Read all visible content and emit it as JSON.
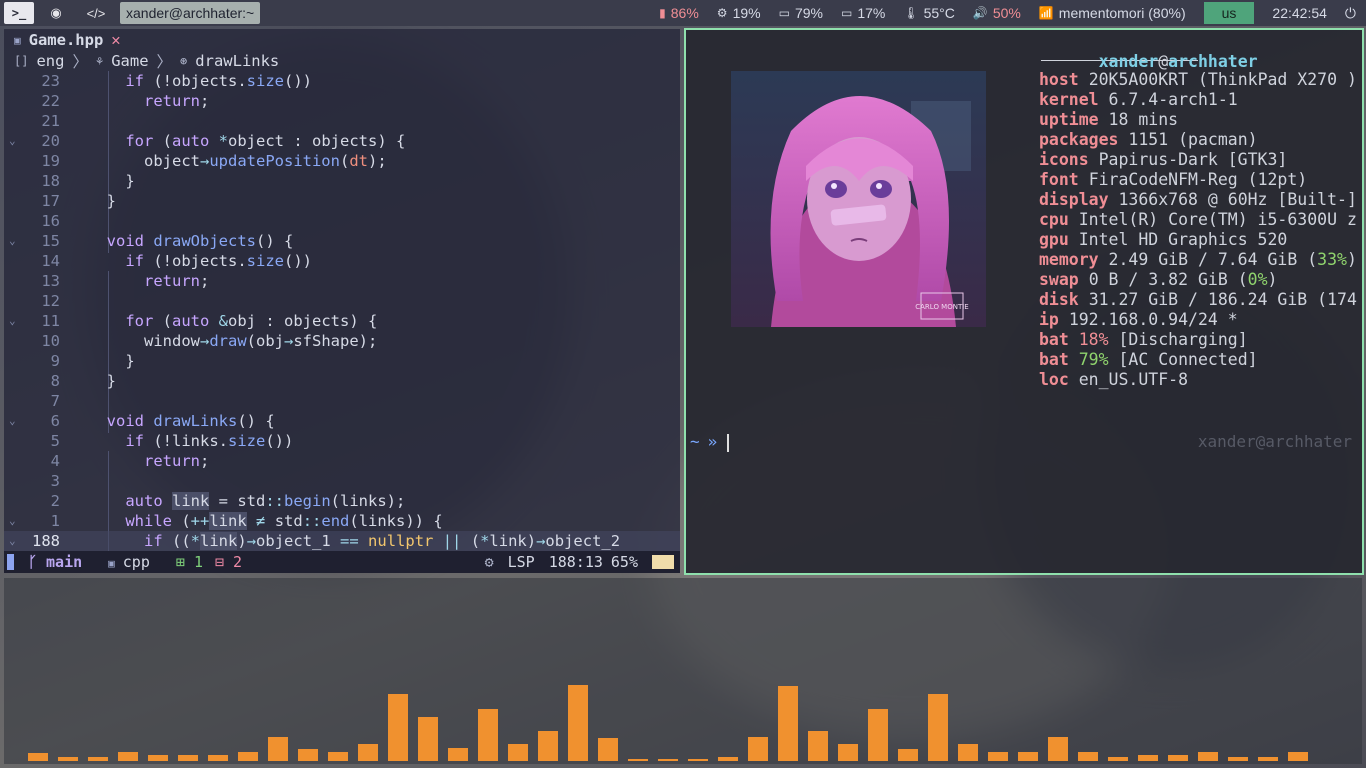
{
  "topbar": {
    "title": "xander@archhater:~",
    "stats": [
      {
        "name": "memory",
        "icon": "memory-icon",
        "glyph": "▮",
        "value": "86%",
        "color": "#f08e95"
      },
      {
        "name": "cpu",
        "icon": "cpu-gear-icon",
        "glyph": "⚙",
        "value": "19%",
        "color": "#d6dae6"
      },
      {
        "name": "battery1",
        "icon": "battery-icon",
        "glyph": "▭",
        "value": "79%",
        "color": "#d6dae6"
      },
      {
        "name": "battery2",
        "icon": "battery-icon",
        "glyph": "▭",
        "value": "17%",
        "color": "#d6dae6"
      },
      {
        "name": "temperature",
        "icon": "thermometer-icon",
        "glyph": "🌡",
        "value": "55°C",
        "color": "#d6dae6"
      },
      {
        "name": "volume",
        "icon": "volume-icon",
        "glyph": "🔊",
        "value": "50%",
        "color": "#f08e95"
      },
      {
        "name": "wifi",
        "icon": "wifi-icon",
        "glyph": "📶",
        "value": "mementomori (80%)",
        "color": "#d6dae6"
      }
    ],
    "keyboard_layout": "us",
    "clock": "22:42:54"
  },
  "editor": {
    "tab_label": "Game.hpp",
    "breadcrumbs": [
      "eng",
      "Game",
      "drawLinks"
    ],
    "lines": [
      {
        "n": "23",
        "fold": "",
        "html": "    <span class='kw'>if</span> (!objects.<span class='fn'>size</span>())"
      },
      {
        "n": "22",
        "fold": "",
        "html": "      <span class='kw'>return</span>;"
      },
      {
        "n": "21",
        "fold": "",
        "html": ""
      },
      {
        "n": "20",
        "fold": "v",
        "html": "    <span class='kw'>for</span> (<span class='kw'>auto</span> <span class='op'>*</span>object : objects) {"
      },
      {
        "n": "19",
        "fold": "",
        "html": "      object<span class='op'>→</span><span class='fn'>updatePosition</span>(<span class='pm'>dt</span>);"
      },
      {
        "n": "18",
        "fold": "",
        "html": "    }"
      },
      {
        "n": "17",
        "fold": "",
        "html": "  }"
      },
      {
        "n": "16",
        "fold": "",
        "html": ""
      },
      {
        "n": "15",
        "fold": "v",
        "html": "  <span class='kw'>void</span> <span class='fn'>drawObjects</span>() {"
      },
      {
        "n": "14",
        "fold": "",
        "html": "    <span class='kw'>if</span> (!objects.<span class='fn'>size</span>())"
      },
      {
        "n": "13",
        "fold": "",
        "html": "      <span class='kw'>return</span>;"
      },
      {
        "n": "12",
        "fold": "",
        "html": ""
      },
      {
        "n": "11",
        "fold": "v",
        "html": "    <span class='kw'>for</span> (<span class='kw'>auto</span> <span class='op'>&amp;</span>obj : objects) {"
      },
      {
        "n": "10",
        "fold": "",
        "html": "      window<span class='op'>→</span><span class='fn'>draw</span>(obj<span class='op'>→</span>sfShape);"
      },
      {
        "n": "9",
        "fold": "",
        "html": "    }"
      },
      {
        "n": "8",
        "fold": "",
        "html": "  }"
      },
      {
        "n": "7",
        "fold": "",
        "html": ""
      },
      {
        "n": "6",
        "fold": "v",
        "html": "  <span class='kw'>void</span> <span class='fn'>drawLinks</span>() {"
      },
      {
        "n": "5",
        "fold": "",
        "html": "    <span class='kw'>if</span> (!links.<span class='fn'>size</span>())"
      },
      {
        "n": "4",
        "fold": "",
        "html": "      <span class='kw'>return</span>;"
      },
      {
        "n": "3",
        "fold": "",
        "html": ""
      },
      {
        "n": "2",
        "fold": "",
        "html": "    <span class='kw'>auto</span> <span class='hl'>link</span> = std<span class='op'>::</span><span class='fn'>begin</span>(links);"
      },
      {
        "n": "1",
        "fold": "v",
        "html": "    <span class='kw'>while</span> (<span class='op'>++</span><span class='hl'>link</span> <span class='op'>≠</span> std<span class='op'>::</span><span class='fn'>end</span>(links)) {"
      },
      {
        "n": "188",
        "fold": "v",
        "current": true,
        "html": "      <span class='kw'>if</span> ((<span class='op'>*</span><span class='hl'>link</span>)<span class='op'>→</span>object_1 <span class='op'>==</span> <span class='nl'>nullptr</span> <span class='op'>||</span> (<span class='op'>*</span>link)<span class='op'>→</span>object_2"
      }
    ],
    "status": {
      "branch": "main",
      "filetype": "cpp",
      "added": "1",
      "removed": "2",
      "lsp": "LSP",
      "position": "188:13",
      "percent": "65%"
    }
  },
  "fetch": {
    "user": "xander",
    "at": "@",
    "host": "archhater",
    "rows": [
      {
        "key": "host",
        "value": "20K5A00KRT (ThinkPad X270 )"
      },
      {
        "key": "kernel",
        "value": "6.7.4-arch1-1"
      },
      {
        "key": "uptime",
        "value": "18 mins"
      },
      {
        "key": "packages",
        "value": "1151 (pacman)"
      },
      {
        "key": "icons",
        "value": "Papirus-Dark [GTK3]"
      },
      {
        "key": "font",
        "value": "FiraCodeNFM-Reg (12pt)"
      },
      {
        "key": "display",
        "value": "1366x768 @ 60Hz [Built-]"
      },
      {
        "key": "cpu",
        "value": "Intel(R) Core(TM) i5-6300U z"
      },
      {
        "key": "gpu",
        "value": "Intel HD Graphics 520"
      },
      {
        "key": "memory",
        "value": "2.49 GiB / 7.64 GiB (",
        "pct": "33%",
        "pctColor": "g",
        "tail": ")"
      },
      {
        "key": "swap",
        "value": "0 B / 3.82 GiB (",
        "pct": "0%",
        "pctColor": "g",
        "tail": ")"
      },
      {
        "key": "disk",
        "value": "31.27 GiB / 186.24 GiB (174"
      },
      {
        "key": "ip",
        "value": "192.168.0.94/24 *"
      },
      {
        "key": "bat",
        "value": "",
        "pct": "18%",
        "pctColor": "r",
        "tail": " [Discharging]"
      },
      {
        "key": "bat",
        "value": "",
        "pct": "79%",
        "pctColor": "g",
        "tail": " [AC Connected]"
      },
      {
        "key": "loc",
        "value": "en_US.UTF-8"
      }
    ],
    "prompt_tilde": "~",
    "prompt_arrow": "»",
    "right_prompt": "xander@archhater",
    "art_watermark": "CARLO MONTIE"
  },
  "visualizer": {
    "bars": [
      8,
      4,
      4,
      9,
      6,
      6,
      6,
      9,
      24,
      12,
      9,
      17,
      67,
      44,
      13,
      52,
      17,
      30,
      76,
      23,
      2,
      2,
      2,
      4,
      24,
      75,
      30,
      17,
      52,
      12,
      67,
      17,
      9,
      9,
      24,
      9,
      4,
      6,
      6,
      9,
      4,
      4,
      9
    ],
    "color": "#f0912f"
  }
}
